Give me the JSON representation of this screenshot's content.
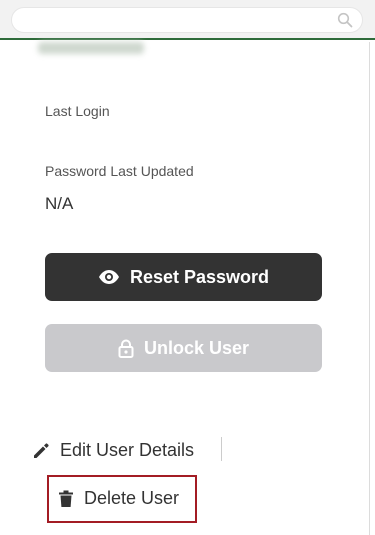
{
  "search": {
    "placeholder": "",
    "icon": "search-icon"
  },
  "user": {
    "last_login_label": "Last Login",
    "password_updated_label": "Password Last Updated",
    "password_updated_value": "N/A"
  },
  "buttons": {
    "reset_password": {
      "label": "Reset Password",
      "icon": "eye-icon"
    },
    "unlock_user": {
      "label": "Unlock User",
      "icon": "lock-icon",
      "disabled": true
    }
  },
  "actions": {
    "edit_user_details": {
      "label": "Edit User Details",
      "icon": "pencil-icon"
    },
    "delete_user": {
      "label": "Delete User",
      "icon": "trash-icon",
      "highlight_color": "#a31c24"
    }
  },
  "colors": {
    "accent_rule": "#2e6b3a",
    "primary_button": "#333333",
    "disabled_button": "#c9c9cc"
  }
}
